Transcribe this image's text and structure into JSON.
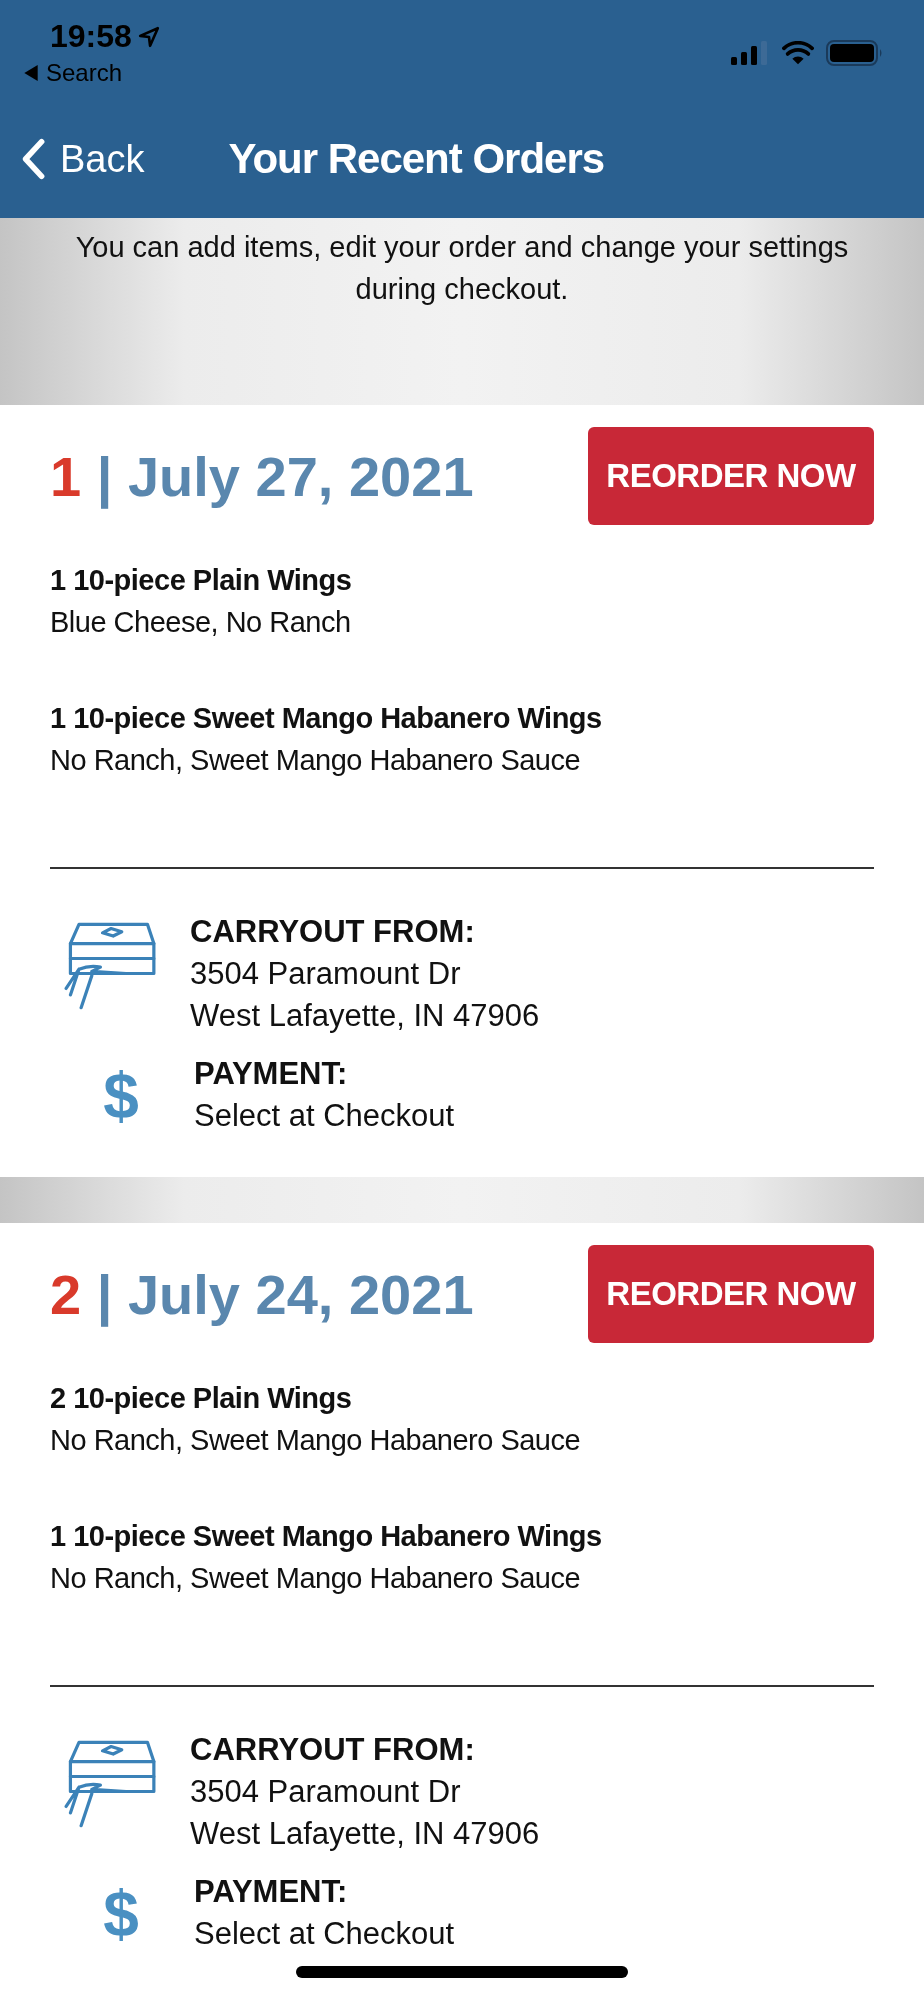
{
  "status_bar": {
    "time": "19:58",
    "back_app": "Search"
  },
  "nav": {
    "back": "Back",
    "title": "Your Recent Orders"
  },
  "banner": "You can add items, edit your order and change your settings during checkout.",
  "orders": [
    {
      "number": "1",
      "separator": "|",
      "date": "July 27, 2021",
      "button": "REORDER NOW",
      "items": [
        {
          "name": "1 10-piece Plain Wings",
          "options": "Blue Cheese, No Ranch"
        },
        {
          "name": "1 10-piece Sweet Mango Habanero Wings",
          "options": "No Ranch, Sweet Mango Habanero Sauce"
        }
      ],
      "carryout": {
        "label": "CARRYOUT FROM:",
        "lines": [
          "3504 Paramount Dr",
          "West Lafayette, IN 47906"
        ]
      },
      "payment": {
        "icon": "$",
        "label": "PAYMENT:",
        "value": "Select at Checkout"
      }
    },
    {
      "number": "2",
      "separator": "|",
      "date": "July 24, 2021",
      "button": "REORDER NOW",
      "items": [
        {
          "name": "2 10-piece Plain Wings",
          "options": "No Ranch, Sweet Mango Habanero Sauce"
        },
        {
          "name": "1 10-piece Sweet Mango Habanero Wings",
          "options": "No Ranch, Sweet Mango Habanero Sauce"
        }
      ],
      "carryout": {
        "label": "CARRYOUT FROM:",
        "lines": [
          "3504 Paramount Dr",
          "West Lafayette, IN 47906"
        ]
      },
      "payment": {
        "icon": "$",
        "label": "PAYMENT:",
        "value": "Select at Checkout"
      }
    }
  ]
}
